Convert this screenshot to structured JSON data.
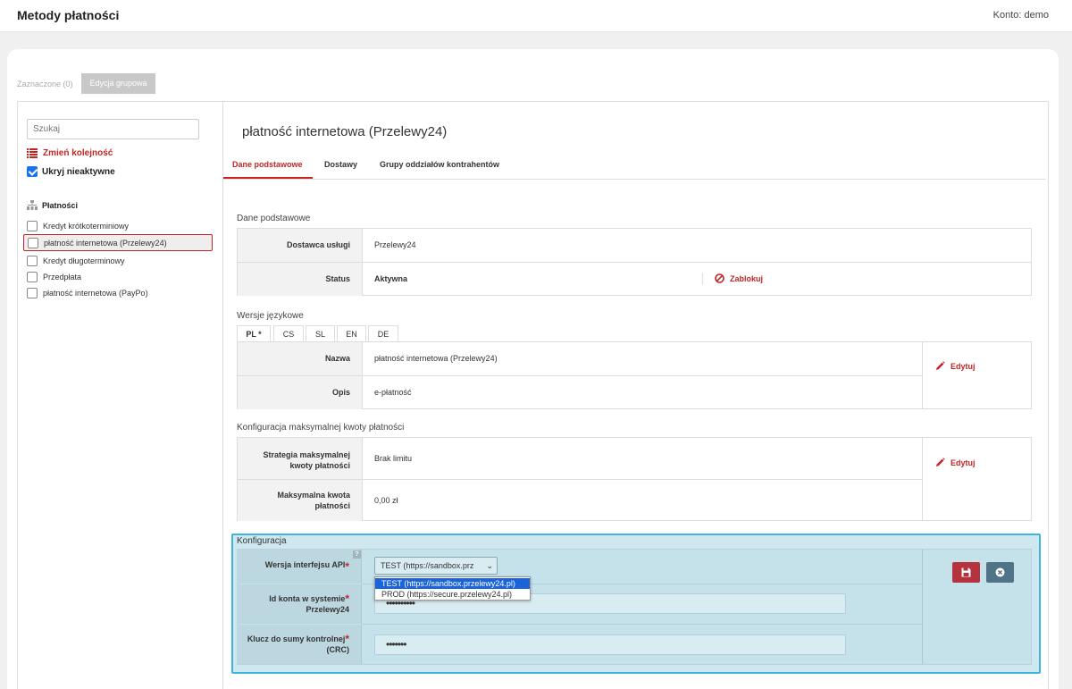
{
  "header": {
    "title": "Metody płatności",
    "account": "Konto: demo"
  },
  "toolbar": {
    "selected": "Zaznaczone (0)",
    "group_edit": "Edycja grupowa"
  },
  "sidebar": {
    "search_placeholder": "Szukaj",
    "reorder": "Zmień kolejność",
    "hide_inactive": "Ukryj nieaktywne",
    "root": "Płatności",
    "items": [
      {
        "label": "Kredyt krótkoterminiowy"
      },
      {
        "label": "płatność internetowa (Przelewy24)"
      },
      {
        "label": "Kredyt długoterminowy"
      },
      {
        "label": "Przedpłata"
      },
      {
        "label": "płatność internetowa (PayPo)"
      }
    ]
  },
  "main": {
    "title": "płatność internetowa (Przelewy24)",
    "tabs": [
      "Dane podstawowe",
      "Dostawy",
      "Grupy oddziałów kontrahentów"
    ],
    "basic": {
      "section": "Dane podstawowe",
      "provider_label": "Dostawca usługi",
      "provider_value": "Przelewy24",
      "status_label": "Status",
      "status_value": "Aktywna",
      "block": "Zablokuj"
    },
    "lang": {
      "section": "Wersje językowe",
      "tabs": [
        "PL *",
        "CS",
        "SL",
        "EN",
        "DE"
      ],
      "name_label": "Nazwa",
      "name_value": "płatność internetowa (Przelewy24)",
      "desc_label": "Opis",
      "desc_value": "e-płatność",
      "edit": "Edytuj"
    },
    "limit": {
      "section": "Konfiguracja maksymalnej kwoty płatności",
      "strategy_label_1": "Strategia maksymalnej",
      "strategy_label_2": "kwoty płatności",
      "strategy_value": "Brak limitu",
      "max_label_1": "Maksymalna kwota",
      "max_label_2": "płatności",
      "max_value": "0,00 zł",
      "edit": "Edytuj"
    },
    "config": {
      "section": "Konfiguracja",
      "api_label": "Wersja interfejsu API",
      "api_selected": "TEST (https://sandbox.prz",
      "api_options": [
        "TEST (https://sandbox.przelewy24.pl)",
        "PROD (https://secure.przelewy24.pl)"
      ],
      "account_label_1": "Id konta w systemie",
      "account_label_2": "Przelewy24",
      "account_value": "••••••••••",
      "crc_label_1": "Klucz do sumy kontrolnej",
      "crc_label_2": "(CRC)",
      "crc_value": "•••••••",
      "help": "?"
    }
  },
  "colors": {
    "accent": "#c32525",
    "config_border": "#3fb4dc",
    "config_bg": "#cfe7ef"
  }
}
